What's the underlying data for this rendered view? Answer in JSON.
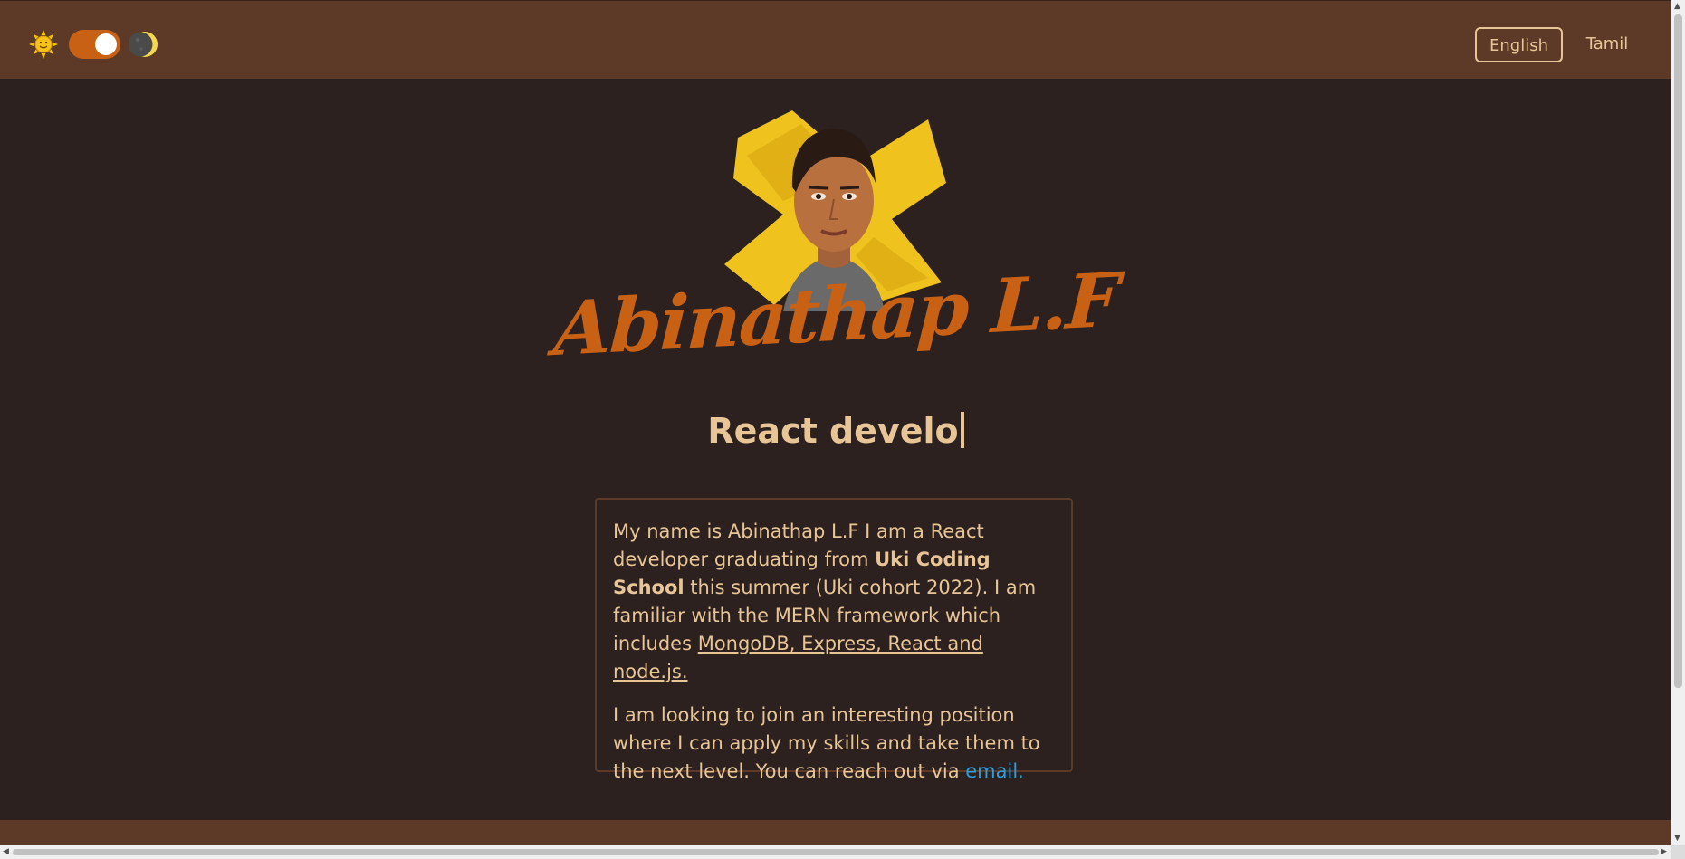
{
  "header": {
    "theme_toggle": {
      "light_icon": "sun-icon",
      "dark_icon": "moon-icon",
      "state": "dark"
    },
    "languages": [
      {
        "label": "English",
        "active": true
      },
      {
        "label": "Tamil",
        "active": false
      }
    ]
  },
  "hero": {
    "avatar_icon": "portrait-avatar",
    "name": "Abinathap L.F",
    "typing_text": "React develo"
  },
  "bio": {
    "p1_a": "My name is Abinathap L.F I am a React developer graduating from ",
    "p1_school": "Uki Coding School",
    "p1_b": " this summer (Uki cohort 2022). I am familiar with the MERN framework which includes ",
    "p1_stack": "MongoDB, Express, React and node.js.",
    "p2_a": "I am looking to join an interesting position where I can apply my skills and take them to the next level. You can reach out via ",
    "p2_link": "email."
  },
  "colors": {
    "header_bg": "#5c3a27",
    "page_bg": "#2c211f",
    "accent": "#c96115",
    "text": "#e8c596",
    "link": "#2a9ee0"
  }
}
